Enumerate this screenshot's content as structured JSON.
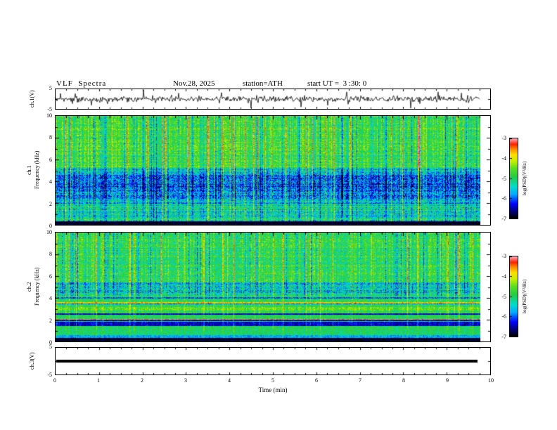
{
  "header": {
    "title": "VLF  Spectra",
    "date": "Nov.28, 2025",
    "station": "station=ATH",
    "start_ut": "start UT =  3 :30: 0"
  },
  "xaxis": {
    "label": "Time (min)",
    "tick_labels": [
      "0",
      "1",
      "2",
      "3",
      "4",
      "5",
      "6",
      "7",
      "8",
      "9",
      "10"
    ],
    "xlim": [
      0,
      10
    ]
  },
  "colormap": [
    [
      0.0,
      "#000000"
    ],
    [
      0.09,
      "#000080"
    ],
    [
      0.18,
      "#0000ff"
    ],
    [
      0.3,
      "#00aaff"
    ],
    [
      0.4,
      "#00ddcc"
    ],
    [
      0.52,
      "#22cc44"
    ],
    [
      0.62,
      "#55dd22"
    ],
    [
      0.72,
      "#c8ee00"
    ],
    [
      0.8,
      "#ffdd00"
    ],
    [
      0.87,
      "#ff8800"
    ],
    [
      0.93,
      "#ff2200"
    ],
    [
      1.0,
      "#ffaabb"
    ]
  ],
  "chart_data": [
    {
      "id": "wave1",
      "type": "line",
      "ylabel": "ch.1(V)",
      "ylim": [
        -5,
        5
      ],
      "ytick_labels": [
        "5",
        "-5"
      ],
      "xlim": [
        0,
        10
      ],
      "x_end": 9.75,
      "seed": 11,
      "signal": {
        "baseline_sigma": 0.8,
        "spike_prob": 0.05,
        "spike_amp": [
          2,
          5
        ]
      },
      "description": "noisy broadband waveform around 0 V with impulsive spikes up to ±5 V"
    },
    {
      "id": "spec1",
      "type": "heatmap",
      "ylabel": [
        "ch.1",
        "Frequency (kHz)"
      ],
      "ylim": [
        0,
        10
      ],
      "ytick_labels": [
        "10",
        "8",
        "6",
        "4",
        "2",
        "0"
      ],
      "xlim": [
        0,
        10
      ],
      "x_end": 9.75,
      "seed": 7,
      "colorbar": {
        "label": "log(PSD)(V²/Hz)",
        "tick_labels": [
          "-3",
          "-4",
          "-5",
          "-6",
          "-7"
        ],
        "range": [
          -7,
          -3
        ]
      },
      "streaks": {
        "strong_prob": 0.09,
        "strong": [
          0.18,
          0.42
        ],
        "neg_prob": 0.1,
        "neg": [
          0.1,
          0.28
        ],
        "jitter": 0.09
      },
      "bands": [
        {
          "f": [
            0,
            0.35
          ],
          "t": 0.03,
          "noise": 0.04,
          "row_amp": 0,
          "streak": 0.05
        },
        {
          "f": [
            0.35,
            1.9
          ],
          "t": 0.45,
          "noise": 0.15,
          "row_amp": 0.1,
          "streak": 0.7
        },
        {
          "f": [
            1.9,
            2.4
          ],
          "t": 0.36,
          "noise": 0.15,
          "row_amp": 0.08,
          "streak": 0.8
        },
        {
          "f": [
            2.4,
            3.2
          ],
          "t": 0.28,
          "noise": 0.16,
          "row_amp": 0.07,
          "streak": 0.9
        },
        {
          "f": [
            3.2,
            4.6
          ],
          "t": 0.24,
          "noise": 0.16,
          "row_amp": 0.07,
          "streak": 0.9
        },
        {
          "f": [
            4.6,
            5.2
          ],
          "t": 0.38,
          "noise": 0.15,
          "row_amp": 0.06,
          "streak": 1.0
        },
        {
          "f": [
            5.2,
            10
          ],
          "t": 0.55,
          "noise": 0.12,
          "row_amp": 0.05,
          "streak": 1.0
        }
      ]
    },
    {
      "id": "spec2",
      "type": "heatmap",
      "ylabel": [
        "ch.2",
        "Frequency (kHz)"
      ],
      "ylim": [
        0,
        10
      ],
      "ytick_labels": [
        "10",
        "8",
        "6",
        "4",
        "2",
        "0"
      ],
      "xlim": [
        0,
        10
      ],
      "x_end": 9.75,
      "seed": 13,
      "colorbar": {
        "label": "log(PSD)(V²/Hz)",
        "tick_labels": [
          "-3",
          "-4",
          "-5",
          "-6",
          "-7"
        ],
        "range": [
          -7,
          -3
        ]
      },
      "streaks": {
        "strong_prob": 0.08,
        "strong": [
          0.16,
          0.4
        ],
        "neg_prob": 0.1,
        "neg": [
          0.1,
          0.26
        ],
        "jitter": 0.08
      },
      "bands": [
        {
          "f": [
            0,
            0.3
          ],
          "t": 0.03,
          "noise": 0.04,
          "row_amp": 0,
          "streak": 0.05
        },
        {
          "f": [
            0.3,
            1.0
          ],
          "t": 0.45,
          "noise": 0.08,
          "row_amp": 0,
          "streak": 0.25,
          "strat": [
            [
              0.22,
              0.8
            ],
            [
              0.3,
              0.5
            ],
            [
              0.28,
              0.32
            ],
            [
              0.2,
              0.1
            ]
          ]
        },
        {
          "f": [
            1.0,
            2.6
          ],
          "t": 0.5,
          "noise": 0.08,
          "row_amp": 0,
          "streak": 0.35,
          "strat": [
            [
              0.2,
              0.85
            ],
            [
              0.45,
              0.52
            ],
            [
              0.15,
              0.65
            ],
            [
              0.2,
              0.15
            ]
          ]
        },
        {
          "f": [
            2.6,
            4.2
          ],
          "t": 0.5,
          "noise": 0.1,
          "row_amp": 0,
          "streak": 0.5,
          "strat": [
            [
              0.1,
              0.8
            ],
            [
              0.55,
              0.52
            ],
            [
              0.2,
              0.62
            ],
            [
              0.15,
              0.25
            ]
          ]
        },
        {
          "f": [
            4.2,
            5.4
          ],
          "t": 0.4,
          "noise": 0.16,
          "row_amp": 0.08,
          "streak": 0.9
        },
        {
          "f": [
            5.4,
            10
          ],
          "t": 0.53,
          "noise": 0.13,
          "row_amp": 0.05,
          "streak": 1.0
        }
      ]
    },
    {
      "id": "wave3",
      "type": "line",
      "ylabel": "ch.3(V)",
      "ylim": [
        -5,
        5
      ],
      "ytick_labels": [
        "5",
        "-5"
      ],
      "xlim": [
        0,
        10
      ],
      "x_end": 9.7,
      "seed": 3,
      "signal": {
        "flat": true,
        "value": 0
      },
      "description": "flat (no signal) trace drawn as a thick black line at 0 V"
    }
  ]
}
